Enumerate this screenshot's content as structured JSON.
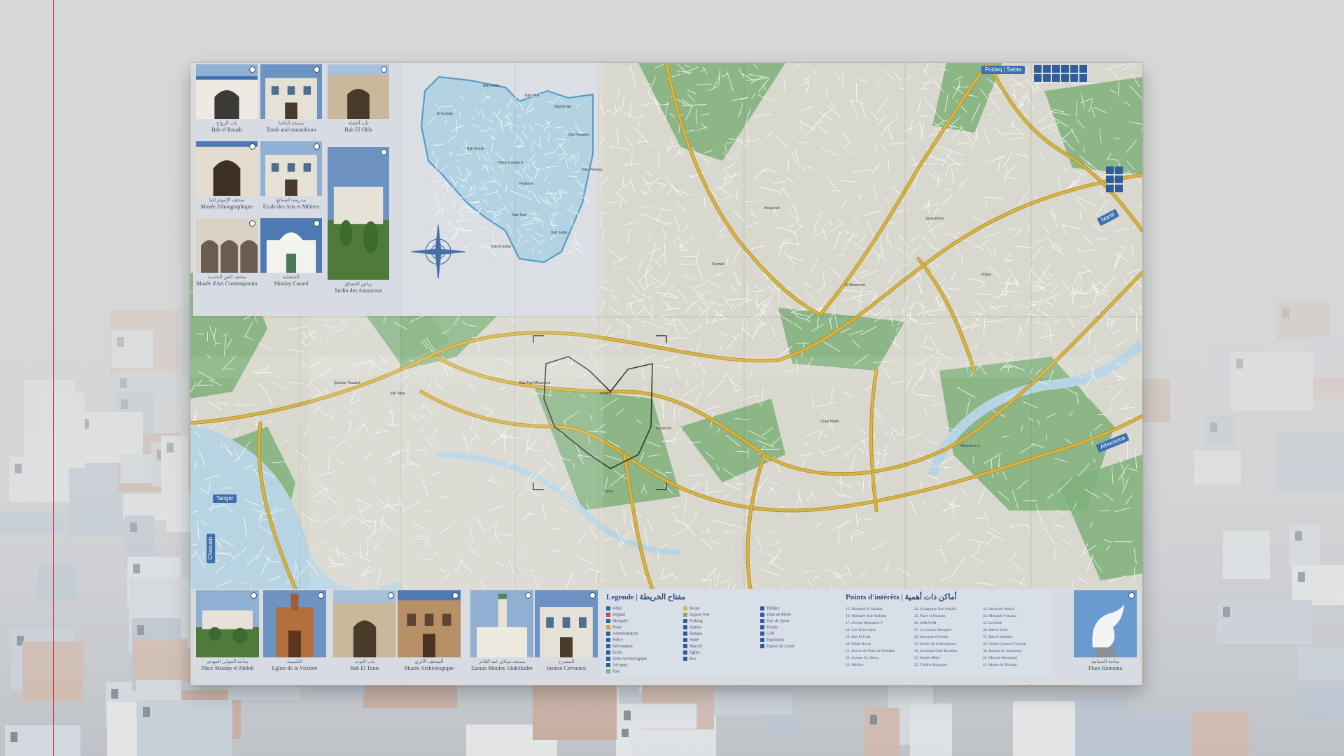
{
  "scene": {
    "accent": "#2f5d9c",
    "map_colors": {
      "land": "#d9d8cf",
      "park": "#7fb07a",
      "river": "#b8d4e3",
      "road": "#d9b542",
      "medina": "#a9cde0"
    }
  },
  "top_photos": [
    {
      "ar": "باب الرواح",
      "fr": "Bab el Rouah",
      "icon": "mosque-gate"
    },
    {
      "ar": "مسجد الباشا",
      "fr": "Tomb and mausoleum",
      "icon": "building"
    },
    {
      "ar": "باب العقلة",
      "fr": "Bab El Okla",
      "icon": "gate"
    },
    {
      "ar": "متحف الإثنوغرافيا",
      "fr": "Musée Ethnographique",
      "icon": "arch"
    },
    {
      "ar": "مدرسة الصنائع",
      "fr": "Ecole des Arts et Métiers",
      "icon": "building"
    },
    {
      "ar": "رياض العشاق",
      "fr": "Jardin des Amoureux",
      "icon": "garden"
    },
    {
      "ar": "متحف الفن الحديث",
      "fr": "Musée d'Art Contemporain",
      "icon": "arcade"
    },
    {
      "ar": "القنصلية",
      "fr": "Moulay Casted",
      "icon": "dome"
    }
  ],
  "bottom_photos": [
    {
      "ar": "ساحة المولى المهدي",
      "fr": "Place Moulay el Mehdi",
      "icon": "garden"
    },
    {
      "ar": "الكنيسة",
      "fr": "Eglise de la Victoire",
      "icon": "church"
    },
    {
      "ar": "باب التوت",
      "fr": "Bab El Touts",
      "icon": "gate"
    },
    {
      "ar": "المتحف الأثري",
      "fr": "Musée Archéologique",
      "icon": "facade"
    },
    {
      "ar": "مسجد مولاي عبد القادر",
      "fr": "Zaouia Moulay Abdelkader",
      "icon": "minaret"
    },
    {
      "ar": "المسرح",
      "fr": "Institut Cervantes",
      "icon": "building"
    },
    {
      "ar": "ساحة الحمامة",
      "fr": "Place Hamama",
      "icon": "dove"
    }
  ],
  "legend": {
    "title": "Legende | مفتاح الخريطة",
    "poi_title": "Points d'intérêts | أماكن ذات أهمية",
    "col1": [
      {
        "label": "Hôtel",
        "color": "#2f5d9c"
      },
      {
        "label": "Hôpital",
        "color": "#c84a3a"
      },
      {
        "label": "Mosquée",
        "color": "#2f5d9c"
      },
      {
        "label": "Poste",
        "color": "#e0a020"
      },
      {
        "label": "Administration",
        "color": "#2f5d9c"
      },
      {
        "label": "Police",
        "color": "#2f5d9c"
      },
      {
        "label": "Information",
        "color": "#2f5d9c"
      },
      {
        "label": "Ecole",
        "color": "#2f5d9c"
      },
      {
        "label": "Zone Archéologique",
        "color": "#2f5d9c"
      },
      {
        "label": "Aéroport",
        "color": "#2f5d9c"
      },
      {
        "label": "Parc",
        "color": "#7fb07a"
      }
    ],
    "col2": [
      {
        "label": "Route",
        "color": "#d9b542"
      },
      {
        "label": "Espace Vert",
        "color": "#7fb07a"
      },
      {
        "label": "Parking",
        "color": "#2f5d9c"
      },
      {
        "label": "Station",
        "color": "#2f5d9c"
      },
      {
        "label": "Banque",
        "color": "#2f5d9c"
      },
      {
        "label": "Stade",
        "color": "#2f5d9c"
      },
      {
        "label": "Marché",
        "color": "#2f5d9c"
      },
      {
        "label": "Eglise",
        "color": "#2f5d9c"
      },
      {
        "label": "Bus",
        "color": "#2f5d9c"
      }
    ],
    "col3": [
      {
        "label": "Théâtre",
        "color": "#2f5d9c"
      },
      {
        "label": "Zone de Pêche",
        "color": "#2f5d9c"
      },
      {
        "label": "Parc de Sport",
        "color": "#2f5d9c"
      },
      {
        "label": "Tennis",
        "color": "#2f5d9c"
      },
      {
        "label": "Golf",
        "color": "#2f5d9c"
      },
      {
        "label": "Equitation",
        "color": "#2f5d9c"
      },
      {
        "label": "Espace de Loisir",
        "color": "#2f5d9c"
      }
    ],
    "poi": [
      [
        "15. Mosquée El Kasbah",
        "16. Mosquée Sidi Abdelah",
        "17. Avenue Mohamed V",
        "18. Les Trois Gares",
        "19. Bab El Uqla",
        "20. Palais Royal",
        "21. Ancien de Place de Fondaks",
        "22. Avenue M. Jibera",
        "23. Médina"
      ],
      [
        "24. Synagogue Ben Oualid",
        "25. Place el Hamam",
        "26. SHEAAM",
        "27. La Grande Mosquée",
        "28. Mosquée el Pacha",
        "29. Musée de la Resistance",
        "30. Ancienne Gare Routière",
        "31. Musée Hôtel",
        "32. Théâtre Espagnol"
      ],
      [
        "33. Ancienne Mairie",
        "34. Mosquée Foucaux",
        "35. La Poste",
        "36. Bab el Souk",
        "37. Bab el Mokabir",
        "38. Centre Culturel Français",
        "39. Banque de Saharaoui",
        "40. Marché Municipal",
        "41. Musée de Tétouan"
      ]
    ]
  },
  "map_tags": [
    {
      "label": "Fnideq | Sebta",
      "icon": "arrow-up-icon"
    },
    {
      "label": "Tanger",
      "icon": "arrow-left-icon"
    },
    {
      "label": "Martil",
      "icon": "arrow-right-icon"
    },
    {
      "label": "Chaouen",
      "icon": "arrow-down-icon"
    },
    {
      "label": "Alhoceima",
      "icon": "arrow-right-icon"
    }
  ],
  "map_labels": [
    "Bab Sebta",
    "Bab Okla",
    "Bab El Jiaf",
    "Place Hassan II",
    "Feddane",
    "Bab Rouah",
    "Bab Tout",
    "Bab Remouz",
    "Bab Saida",
    "Bab M'qabar",
    "El Kasbah",
    "Bab Nouader",
    "Medina",
    "Ensanche",
    "Bab Tout Mhannech",
    "Sidi Talha",
    "Quartier Touabel",
    "El Mhannech",
    "Kaymali",
    "Boujarrah",
    "Oued Martil",
    "Dersa",
    "Mhannech II",
    "Sania Rmel",
    "Kitane"
  ]
}
